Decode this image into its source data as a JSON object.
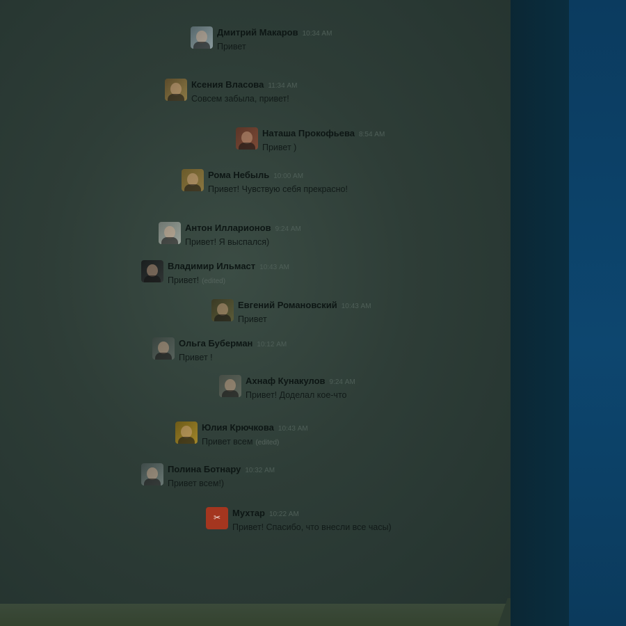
{
  "messages": [
    {
      "name": "Дмитрий Макаров",
      "time": "10:34 AM",
      "text": "Привет",
      "edited": "",
      "avatar": "photo",
      "colors": [
        "#55666a",
        "#8a9a9d"
      ]
    },
    {
      "name": "Ксения Власова",
      "time": "11:34 AM",
      "text": "Совсем забыла, привет!",
      "edited": "",
      "avatar": "photo",
      "colors": [
        "#5a4a2a",
        "#8d7a45"
      ]
    },
    {
      "name": "Наташа Прокофьева",
      "time": "8:54 AM",
      "text": "Привет )",
      "edited": "",
      "avatar": "photo",
      "colors": [
        "#5a3528",
        "#7d4a36"
      ]
    },
    {
      "name": "Рома Небыль",
      "time": "10:00 AM",
      "text": "Привет! Чувствую себя прекрасно!",
      "edited": "",
      "avatar": "photo",
      "colors": [
        "#6a5a2a",
        "#8a7640"
      ]
    },
    {
      "name": "Антон Илларионов",
      "time": "9:24 AM",
      "text": "Привет! Я выспался)",
      "edited": "",
      "avatar": "photo",
      "colors": [
        "#6e7670",
        "#9aa29a"
      ]
    },
    {
      "name": "Владимир Ильмаст",
      "time": "10:43 AM",
      "text": "Привет!",
      "edited": "(edited)",
      "avatar": "photo",
      "colors": [
        "#1a1e1e",
        "#2f3434"
      ]
    },
    {
      "name": "Евгений Романовский",
      "time": "10:43 AM",
      "text": "Привет",
      "edited": "",
      "avatar": "photo",
      "colors": [
        "#3a3a24",
        "#5b5b38"
      ]
    },
    {
      "name": "Ольга Буберман",
      "time": "10:12 AM",
      "text": "Привет  !",
      "edited": "",
      "avatar": "photo",
      "colors": [
        "#39443f",
        "#56615b"
      ]
    },
    {
      "name": "Ахнаф Кунакулов",
      "time": "9:24 AM",
      "text": "Привет! Доделал кое-что",
      "edited": "",
      "avatar": "photo",
      "colors": [
        "#464d45",
        "#5d655b"
      ]
    },
    {
      "name": "Юлия Крючкова",
      "time": "10:43 AM",
      "text": "Привет всем",
      "edited": "(edited)",
      "avatar": "photo",
      "colors": [
        "#6d5a18",
        "#a1862a"
      ]
    },
    {
      "name": "Полина Ботнару",
      "time": "10:32 AM",
      "text": "Привет всем!)",
      "edited": "",
      "avatar": "photo",
      "colors": [
        "#3e4a48",
        "#6a7874"
      ]
    },
    {
      "name": "Мухтар",
      "time": "10:22 AM",
      "text": "Привет! Спасибо, что внесли все часы)",
      "edited": "",
      "avatar": "logo",
      "colors": [
        "#a4361f",
        "#c4472a"
      ]
    }
  ]
}
